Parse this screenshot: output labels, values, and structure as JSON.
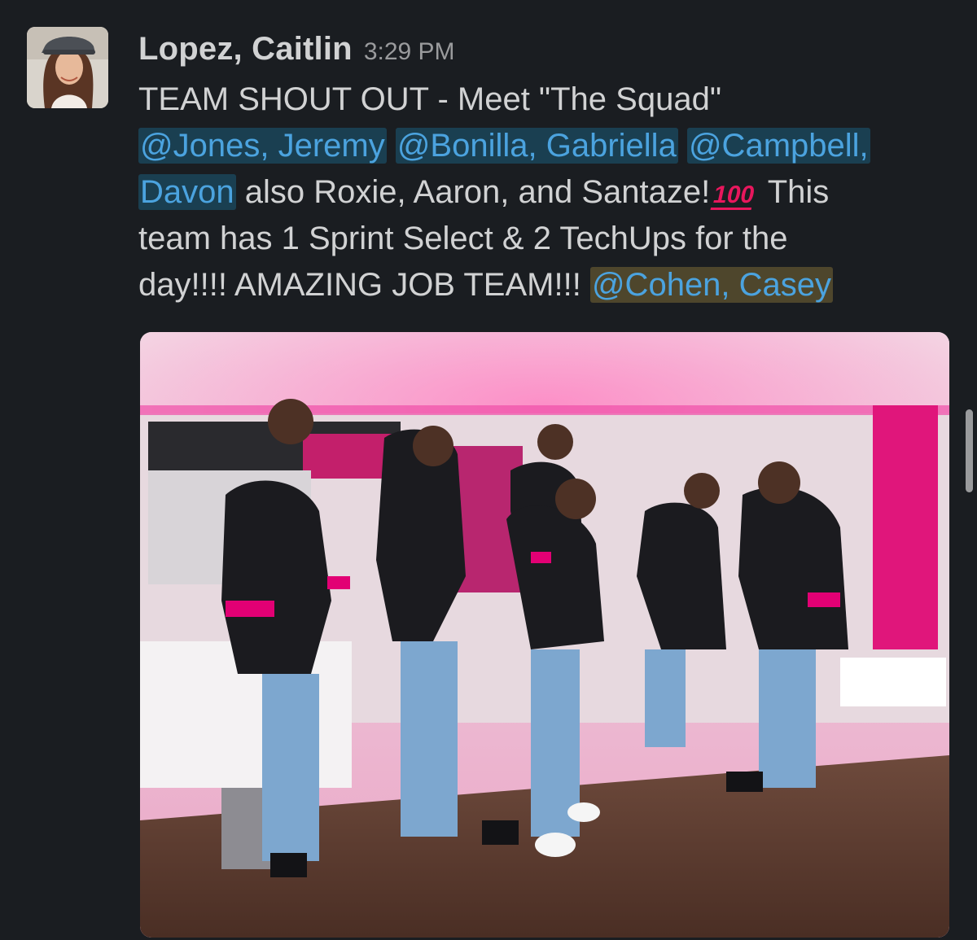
{
  "message": {
    "sender": "Lopez, Caitlin",
    "timestamp": "3:29 PM",
    "lines": [
      {
        "segments": [
          {
            "type": "text",
            "text": "TEAM SHOUT OUT - Meet \"The Squad\""
          }
        ]
      },
      {
        "segments": [
          {
            "type": "mention",
            "text": "@Jones, Jeremy"
          },
          {
            "type": "text",
            "text": " "
          },
          {
            "type": "mention",
            "text": "@Bonilla, Gabriella"
          },
          {
            "type": "text",
            "text": " "
          },
          {
            "type": "mention",
            "text": "@Campbell,"
          }
        ]
      },
      {
        "segments": [
          {
            "type": "mention",
            "text": "Davon"
          },
          {
            "type": "text",
            "text": " also Roxie, Aaron, and Santaze!"
          },
          {
            "type": "emoji",
            "text": "100"
          },
          {
            "type": "text",
            "text": " This"
          }
        ]
      },
      {
        "segments": [
          {
            "type": "text",
            "text": "team has 1 Sprint Select & 2 TechUps for the"
          }
        ]
      },
      {
        "segments": [
          {
            "type": "text",
            "text": "day!!!! AMAZING JOB TEAM!!! "
          },
          {
            "type": "mention-highlight",
            "text": "@Cohen, Casey"
          }
        ]
      }
    ]
  },
  "icons": {
    "avatar": "user-avatar-photo",
    "emoji": "hundred-points-emoji",
    "attachment": "team-photo"
  },
  "colors": {
    "background": "#1a1d21",
    "text": "#d1d2d3",
    "timestamp": "#9a9b9d",
    "mention": "#4ba3df",
    "brand_magenta": "#e20074"
  }
}
